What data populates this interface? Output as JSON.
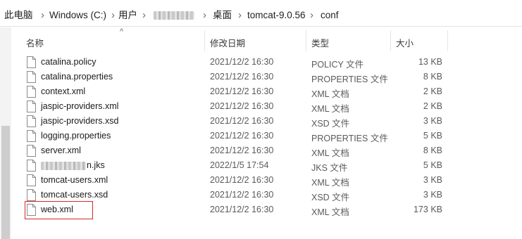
{
  "breadcrumb": {
    "items": [
      "此电脑",
      "Windows (C:)",
      "用户",
      "",
      "桌面",
      "tomcat-9.0.56",
      "conf"
    ],
    "separator": "›"
  },
  "columns": {
    "name": "名称",
    "date": "修改日期",
    "type": "类型",
    "size": "大小"
  },
  "files": [
    {
      "name": "catalina.policy",
      "date": "2021/12/2 16:30",
      "type": "POLICY 文件",
      "size": "13 KB"
    },
    {
      "name": "catalina.properties",
      "date": "2021/12/2 16:30",
      "type": "PROPERTIES 文件",
      "size": "8 KB"
    },
    {
      "name": "context.xml",
      "date": "2021/12/2 16:30",
      "type": "XML 文档",
      "size": "2 KB"
    },
    {
      "name": "jaspic-providers.xml",
      "date": "2021/12/2 16:30",
      "type": "XML 文档",
      "size": "2 KB"
    },
    {
      "name": "jaspic-providers.xsd",
      "date": "2021/12/2 16:30",
      "type": "XSD 文件",
      "size": "3 KB"
    },
    {
      "name": "logging.properties",
      "date": "2021/12/2 16:30",
      "type": "PROPERTIES 文件",
      "size": "5 KB"
    },
    {
      "name": "server.xml",
      "date": "2021/12/2 16:30",
      "type": "XML 文档",
      "size": "8 KB"
    },
    {
      "name": "n.jks",
      "date": "2022/1/5 17:54",
      "type": "JKS 文件",
      "size": "5 KB"
    },
    {
      "name": "tomcat-users.xml",
      "date": "2021/12/2 16:30",
      "type": "XML 文档",
      "size": "3 KB"
    },
    {
      "name": "tomcat-users.xsd",
      "date": "2021/12/2 16:30",
      "type": "XSD 文件",
      "size": "3 KB"
    },
    {
      "name": "web.xml",
      "date": "2021/12/2 16:30",
      "type": "XML 文档",
      "size": "173 KB"
    }
  ],
  "colors": {
    "highlight": "#d9262b",
    "icon": "file-icon"
  }
}
